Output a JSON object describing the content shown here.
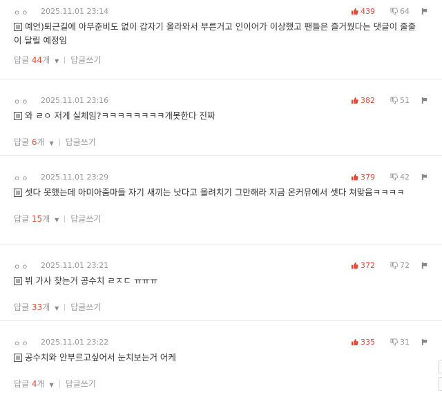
{
  "labels": {
    "reply": "답글",
    "unit": "개",
    "write_reply": "답글쓰기"
  },
  "colors": {
    "accent": "#e64a3b",
    "muted": "#999999"
  },
  "comments": [
    {
      "nick": "ㅇㅇ",
      "date": "2025.11.01 23:14",
      "likes": "439",
      "dislikes": "64",
      "text": "예언)퇴근길에 아무준비도 없이 갑자기 올라와서 부른거고 인이어가 이상했고 팬들은 즐거웠다는 댓글이 줄줄이 달릴 예정임",
      "reply_count": "44"
    },
    {
      "nick": "ㅇㅇ",
      "date": "2025.11.01 23:16",
      "likes": "382",
      "dislikes": "51",
      "text": "와 ㄹㅇ 저게 실체임?ㅋㅋㅋㅋㅋㅋㅋㅋ개못한다 진짜",
      "reply_count": "6"
    },
    {
      "nick": "ㅇㅇ",
      "date": "2025.11.01 23:29",
      "likes": "379",
      "dislikes": "42",
      "text": "셋다 못했는데 아미아줌마들 자기 새끼는 낫다고 올려치기 그만해라 지금 온커뮤에서 셋다 쳐맞음ㅋㅋㅋㅋ",
      "reply_count": "15"
    },
    {
      "nick": "ㅇㅇ",
      "date": "2025.11.01 23:21",
      "likes": "372",
      "dislikes": "72",
      "text": "뷔 가사 찾는거 공수치 ㄹㅈㄷ ㅠㅠㅠ",
      "reply_count": "33"
    },
    {
      "nick": "ㅇㅇ",
      "date": "2025.11.01 23:22",
      "likes": "335",
      "dislikes": "31",
      "text": "공수치와 안부르고싶어서 눈치보는거 어케",
      "reply_count": "4"
    }
  ]
}
